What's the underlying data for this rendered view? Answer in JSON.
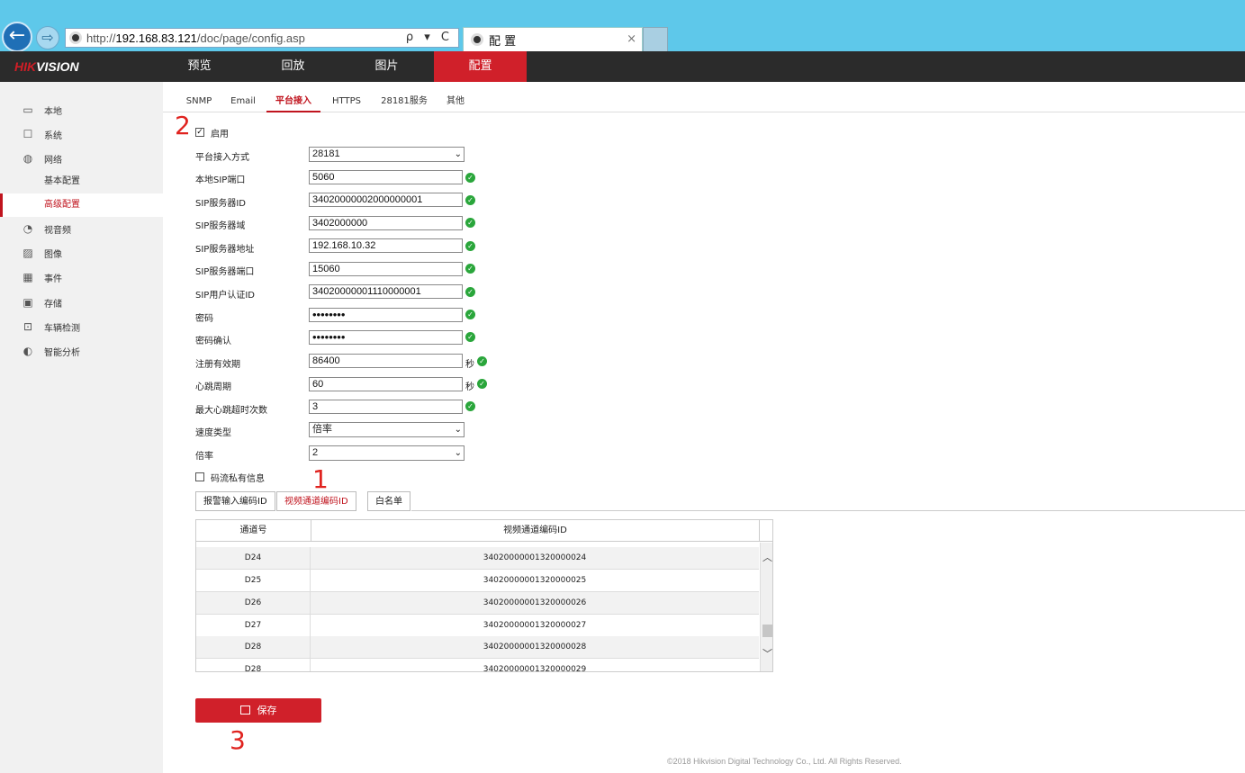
{
  "browser": {
    "url_prefix": "http://",
    "url_host": "192.168.83.121",
    "url_path": "/doc/page/config.asp",
    "tab_title": "配 置",
    "tools": "ρ ▾ C",
    "close": "×"
  },
  "brand": {
    "logo_red": "HIK",
    "logo_white": "VISION"
  },
  "topnav": [
    "预览",
    "回放",
    "图片",
    "配置"
  ],
  "sidebar": {
    "items": [
      {
        "label": "本地",
        "icon": "monitor-icon"
      },
      {
        "label": "系统",
        "icon": "system-icon"
      },
      {
        "label": "网络",
        "icon": "globe-icon"
      },
      {
        "label": "视音频",
        "icon": "video-audio-icon"
      },
      {
        "label": "图像",
        "icon": "image-icon"
      },
      {
        "label": "事件",
        "icon": "calendar-icon"
      },
      {
        "label": "存储",
        "icon": "storage-icon"
      },
      {
        "label": "车辆检测",
        "icon": "vehicle-detect-icon"
      },
      {
        "label": "智能分析",
        "icon": "smart-analysis-icon"
      }
    ],
    "sub_items": [
      "基本配置",
      "高级配置"
    ]
  },
  "subtabs": [
    "SNMP",
    "Email",
    "平台接入",
    "HTTPS",
    "28181服务",
    "其他"
  ],
  "annotations": {
    "a1": "1",
    "a2": "2",
    "a3": "3"
  },
  "form": {
    "enable_label": "启用",
    "access_mode_label": "平台接入方式",
    "access_mode_value": "28181",
    "local_sip_port_label": "本地SIP端口",
    "local_sip_port_value": "5060",
    "sip_server_id_label": "SIP服务器ID",
    "sip_server_id_value": "34020000002000000001",
    "sip_server_domain_label": "SIP服务器域",
    "sip_server_domain_value": "3402000000",
    "sip_server_addr_label": "SIP服务器地址",
    "sip_server_addr_value": "192.168.10.32",
    "sip_server_port_label": "SIP服务器端口",
    "sip_server_port_value": "15060",
    "sip_user_id_label": "SIP用户认证ID",
    "sip_user_id_value": "34020000001110000001",
    "password_label": "密码",
    "password_value": "••••••••",
    "password_confirm_label": "密码确认",
    "password_confirm_value": "••••••••",
    "reg_expiry_label": "注册有效期",
    "reg_expiry_value": "86400",
    "heartbeat_label": "心跳周期",
    "heartbeat_value": "60",
    "unit_sec": "秒",
    "max_timeout_label": "最大心跳超时次数",
    "max_timeout_value": "3",
    "speed_type_label": "速度类型",
    "speed_type_value": "倍率",
    "rate_label": "倍率",
    "rate_value": "2",
    "stream_private_label": "码流私有信息",
    "checkmark": "✓",
    "arrow": "⌄"
  },
  "id_tabs": [
    "报警输入编码ID",
    "视频通道编码ID",
    "白名单"
  ],
  "table": {
    "headers": [
      "通道号",
      "视频通道编码ID"
    ],
    "rows": [
      {
        "ch": "D24",
        "id": "34020000001320000024"
      },
      {
        "ch": "D25",
        "id": "34020000001320000025"
      },
      {
        "ch": "D26",
        "id": "34020000001320000026"
      },
      {
        "ch": "D27",
        "id": "34020000001320000027"
      },
      {
        "ch": "D28",
        "id": "34020000001320000028"
      },
      {
        "ch": "D28",
        "id": "34020000001320000029"
      }
    ]
  },
  "save_label": "保存",
  "footer": "©2018 Hikvision Digital Technology Co., Ltd. All Rights Reserved.",
  "colors": {
    "accent": "#d0202a",
    "ok_green": "#2aa63b",
    "nav_bg": "#2b2b2b",
    "chrome_bg": "#5ec8ea"
  }
}
